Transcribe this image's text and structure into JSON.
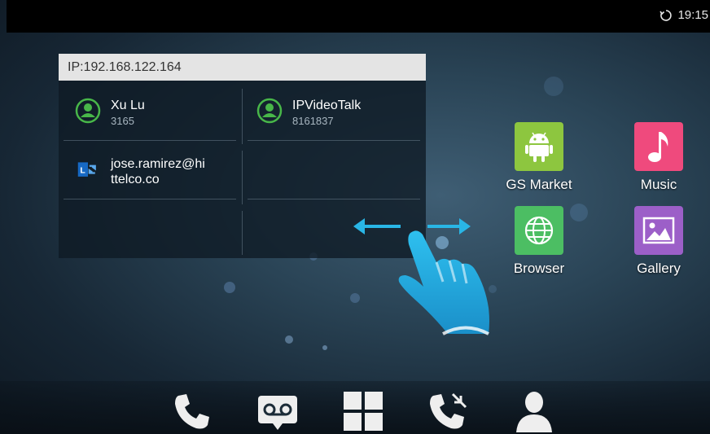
{
  "status_bar": {
    "time": "19:15",
    "sync_icon": "sync-icon"
  },
  "widget": {
    "header": "IP:192.168.122.164",
    "contacts": [
      {
        "name": "Xu Lu",
        "number": "3165",
        "icon": "contact-icon"
      },
      {
        "name": "IPVideoTalk",
        "number": "8161837",
        "icon": "contact-icon"
      },
      {
        "name_line1": "jose.ramirez@hi",
        "name_line2": "ttelco.co",
        "icon": "lync-icon"
      }
    ]
  },
  "apps": [
    {
      "label": "GS Market",
      "icon": "android-icon",
      "color": "#8dc63f"
    },
    {
      "label": "Music",
      "icon": "music-note-icon",
      "color": "#ef4a7d"
    },
    {
      "label": "Browser",
      "icon": "globe-icon",
      "color": "#4cbe63"
    },
    {
      "label": "Gallery",
      "icon": "picture-icon",
      "color": "#9c5fc8"
    }
  ],
  "dock": {
    "items": [
      "phone-icon",
      "voicemail-icon",
      "apps-grid-icon",
      "call-log-icon",
      "contacts-icon"
    ]
  },
  "gesture": {
    "icon": "swipe-hand-icon",
    "color": "#29b6e6"
  }
}
